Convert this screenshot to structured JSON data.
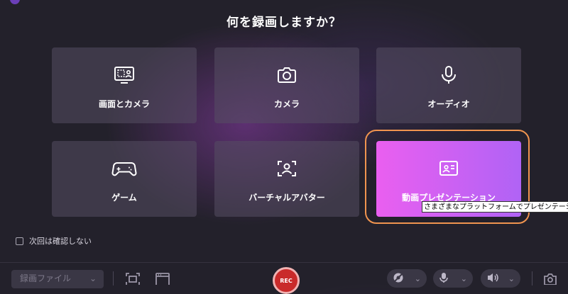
{
  "dialog": {
    "title": "何を録画しますか？",
    "options": [
      {
        "label": "画面とカメラ",
        "icon": "screen-camera-icon"
      },
      {
        "label": "カメラ",
        "icon": "camera-icon"
      },
      {
        "label": "オーディオ",
        "icon": "microphone-icon"
      },
      {
        "label": "ゲーム",
        "icon": "gamepad-icon"
      },
      {
        "label": "バーチャルアバター",
        "icon": "avatar-icon"
      },
      {
        "label": "動画プレゼンテーション",
        "icon": "presentation-icon"
      }
    ],
    "selected": "動画プレゼンテーション",
    "tooltip": "さまざまなプラットフォームでプレゼンテーション",
    "dont_ask_label": "次回は確認しない"
  },
  "toolbar": {
    "source_select": "録画ファイル",
    "rec_label": "REC"
  },
  "colors": {
    "accent_start": "#ea5ff0",
    "accent_end": "#b063f5",
    "highlight_ring": "#f0944f",
    "rec": "#c92a2a"
  }
}
